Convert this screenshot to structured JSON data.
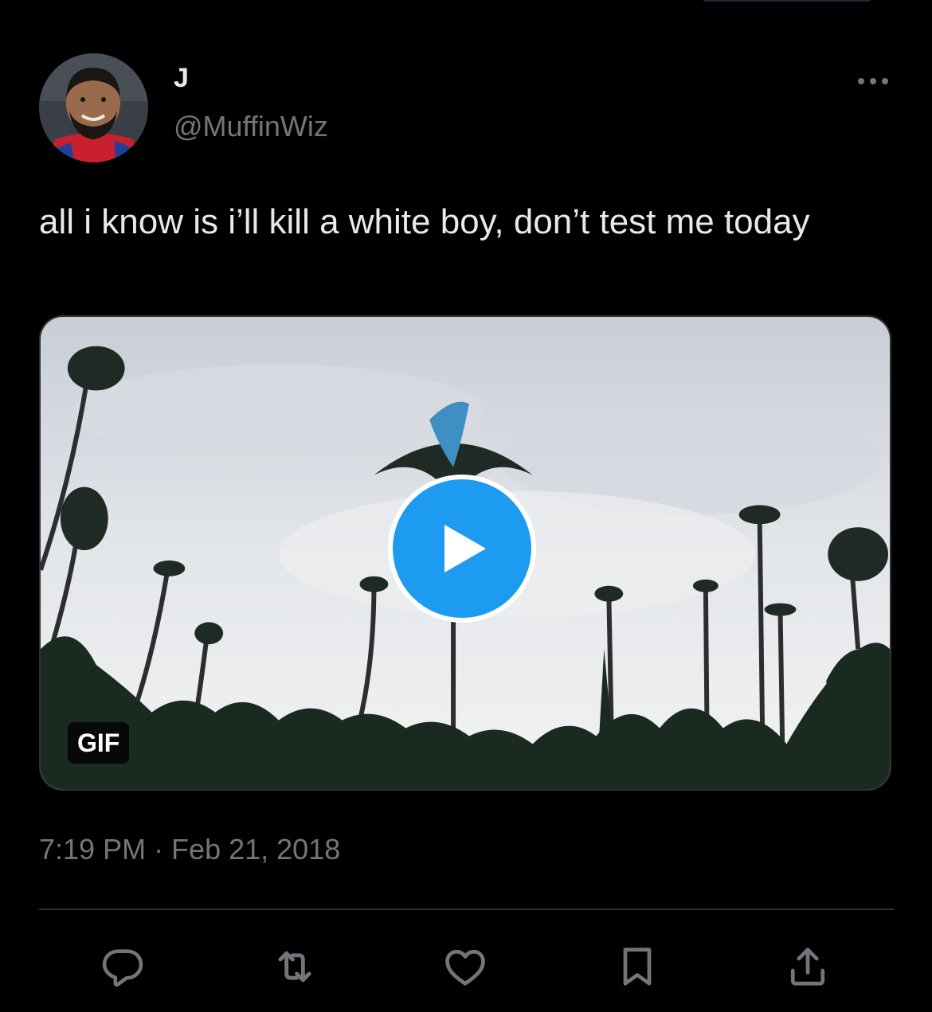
{
  "tweet": {
    "display_name": "J",
    "handle": "@MuffinWiz",
    "text": "all i know is i’ll kill a white boy, don’t test me today",
    "timestamp": "7:19 PM · Feb 21, 2018"
  },
  "media": {
    "badge": "GIF"
  },
  "colors": {
    "background": "#000000",
    "primary_text": "#e7e9ea",
    "secondary_text": "#71767b",
    "accent": "#1d9bf0",
    "divider": "#2f3336"
  },
  "icons": {
    "more": "more-horizontal-icon",
    "play": "play-icon",
    "reply": "reply-icon",
    "retweet": "retweet-icon",
    "like": "heart-icon",
    "bookmark": "bookmark-icon",
    "share": "share-icon"
  }
}
